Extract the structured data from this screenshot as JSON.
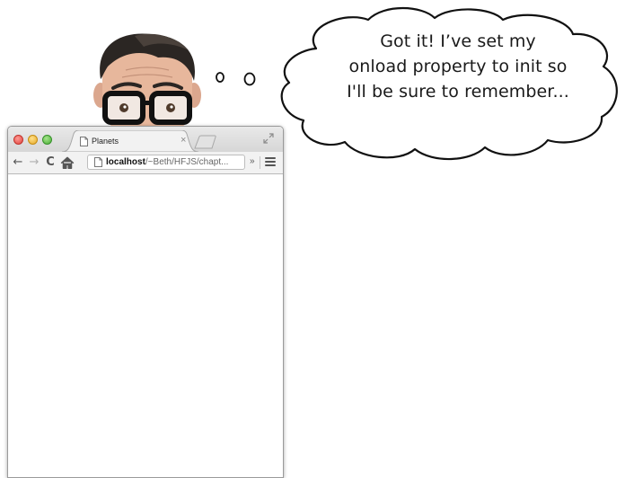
{
  "thought": {
    "lines": [
      "Got it! I’ve set my",
      "onload property to init so",
      "I'll be sure to remember..."
    ]
  },
  "browser": {
    "tab_title": "Planets",
    "tab_close": "×",
    "url": {
      "host": "localhost",
      "path": "/~Beth/HFJS/chapt",
      "ellipsis": "..."
    },
    "toolbar": {
      "back": "←",
      "forward": "→",
      "reload": "C",
      "extensions_chevron": "»"
    },
    "icons": {
      "back": "back-arrow-icon",
      "forward": "forward-arrow-icon",
      "reload": "reload-icon",
      "home": "home-icon",
      "page": "page-icon",
      "menu": "hamburger-menu-icon",
      "fullscreen": "fullscreen-icon"
    }
  },
  "colors": {
    "red_button": "#e0443e",
    "yellow_button": "#e6a928",
    "green_button": "#4aae36"
  }
}
